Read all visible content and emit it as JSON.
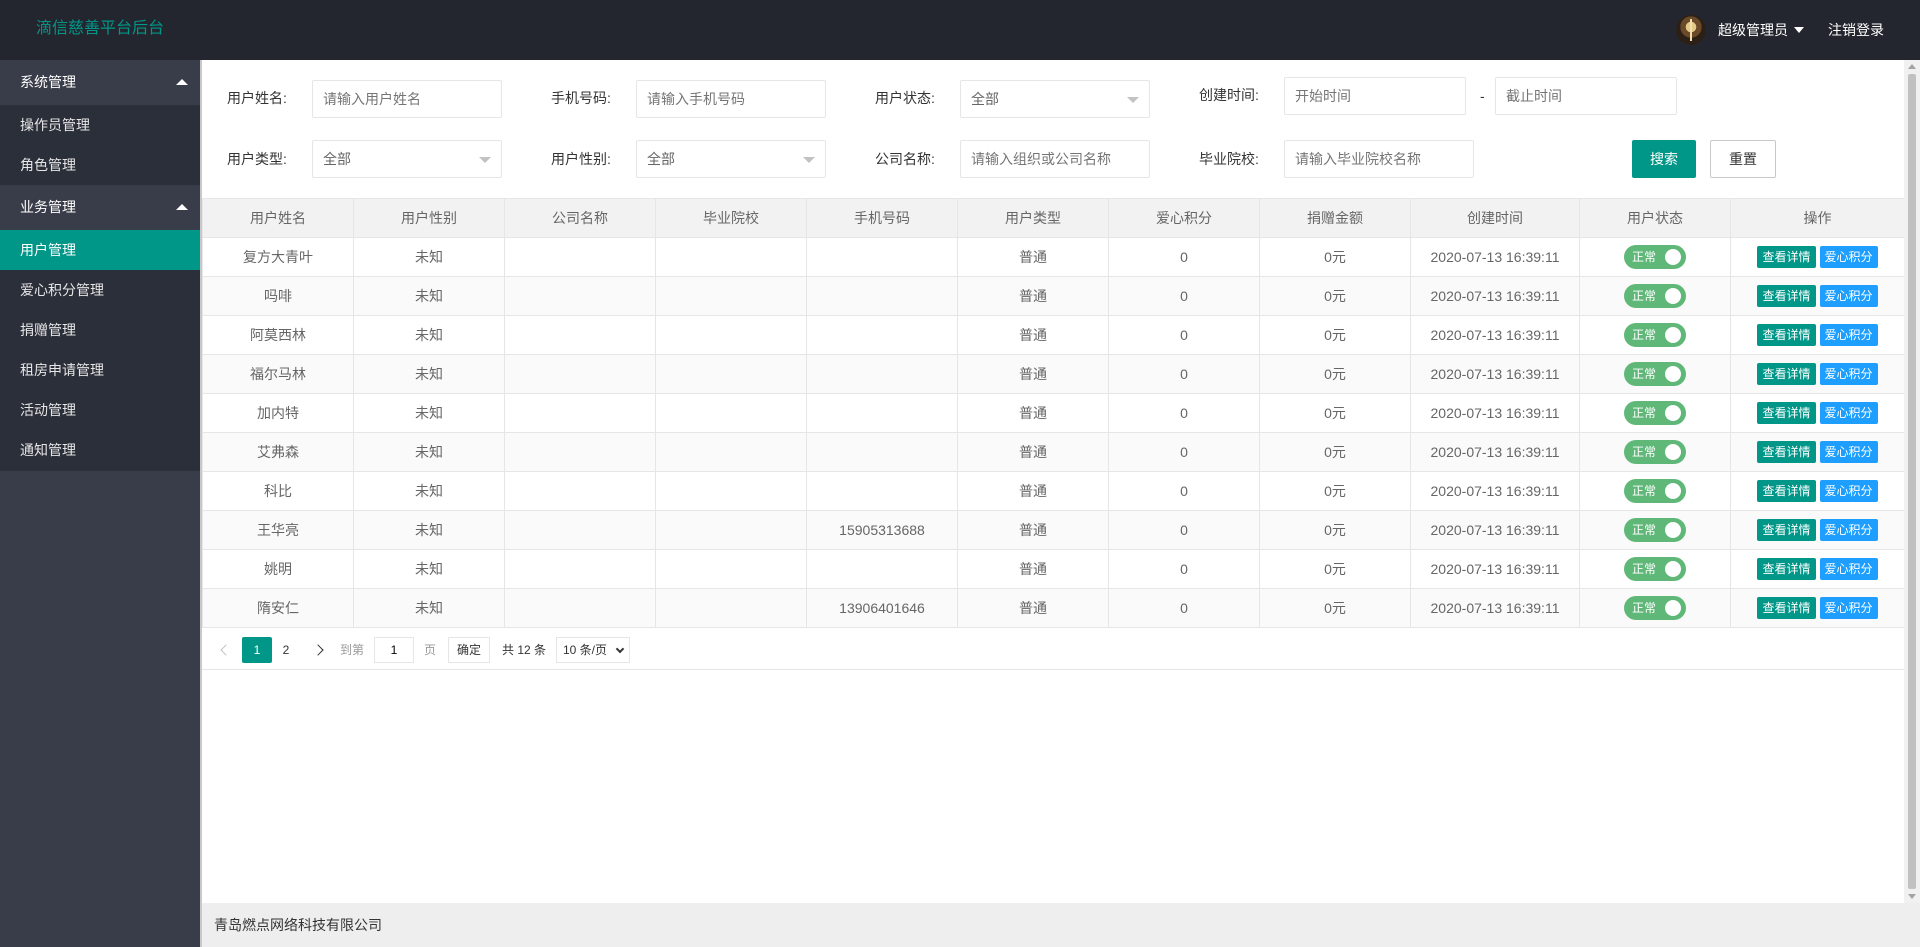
{
  "header": {
    "logo": "滴信慈善平台后台",
    "user_name": "超级管理员",
    "logout": "注销登录"
  },
  "sidebar": {
    "group1": {
      "title": "系统管理",
      "items": [
        {
          "label": "操作员管理"
        },
        {
          "label": "角色管理"
        }
      ]
    },
    "group2": {
      "title": "业务管理",
      "items": [
        {
          "label": "用户管理"
        },
        {
          "label": "爱心积分管理"
        },
        {
          "label": "捐赠管理"
        },
        {
          "label": "租房申请管理"
        },
        {
          "label": "活动管理"
        },
        {
          "label": "通知管理"
        }
      ]
    },
    "active": "用户管理"
  },
  "filters": {
    "name_label": "用户姓名:",
    "name_placeholder": "请输入用户姓名",
    "phone_label": "手机号码:",
    "phone_placeholder": "请输入手机号码",
    "status_label": "用户状态:",
    "status_value": "全部",
    "created_label": "创建时间:",
    "start_placeholder": "开始时间",
    "dash": "-",
    "end_placeholder": "截止时间",
    "type_label": "用户类型:",
    "type_value": "全部",
    "gender_label": "用户性别:",
    "gender_value": "全部",
    "company_label": "公司名称:",
    "company_placeholder": "请输入组织或公司名称",
    "school_label": "毕业院校:",
    "school_placeholder": "请输入毕业院校名称",
    "search_btn": "搜索",
    "reset_btn": "重置"
  },
  "table": {
    "columns": [
      "用户姓名",
      "用户性别",
      "公司名称",
      "毕业院校",
      "手机号码",
      "用户类型",
      "爱心积分",
      "捐赠金额",
      "创建时间",
      "用户状态",
      "操作"
    ],
    "rows": [
      {
        "name": "复方大青叶",
        "gender": "未知",
        "company": "",
        "school": "",
        "phone": "",
        "type": "普通",
        "points": "0",
        "amount": "0元",
        "created": "2020-07-13 16:39:11",
        "status": "正常"
      },
      {
        "name": "吗啡",
        "gender": "未知",
        "company": "",
        "school": "",
        "phone": "",
        "type": "普通",
        "points": "0",
        "amount": "0元",
        "created": "2020-07-13 16:39:11",
        "status": "正常"
      },
      {
        "name": "阿莫西林",
        "gender": "未知",
        "company": "",
        "school": "",
        "phone": "",
        "type": "普通",
        "points": "0",
        "amount": "0元",
        "created": "2020-07-13 16:39:11",
        "status": "正常"
      },
      {
        "name": "福尔马林",
        "gender": "未知",
        "company": "",
        "school": "",
        "phone": "",
        "type": "普通",
        "points": "0",
        "amount": "0元",
        "created": "2020-07-13 16:39:11",
        "status": "正常"
      },
      {
        "name": "加内特",
        "gender": "未知",
        "company": "",
        "school": "",
        "phone": "",
        "type": "普通",
        "points": "0",
        "amount": "0元",
        "created": "2020-07-13 16:39:11",
        "status": "正常"
      },
      {
        "name": "艾弗森",
        "gender": "未知",
        "company": "",
        "school": "",
        "phone": "",
        "type": "普通",
        "points": "0",
        "amount": "0元",
        "created": "2020-07-13 16:39:11",
        "status": "正常"
      },
      {
        "name": "科比",
        "gender": "未知",
        "company": "",
        "school": "",
        "phone": "",
        "type": "普通",
        "points": "0",
        "amount": "0元",
        "created": "2020-07-13 16:39:11",
        "status": "正常"
      },
      {
        "name": "王华亮",
        "gender": "未知",
        "company": "",
        "school": "",
        "phone": "15905313688",
        "type": "普通",
        "points": "0",
        "amount": "0元",
        "created": "2020-07-13 16:39:11",
        "status": "正常"
      },
      {
        "name": "姚明",
        "gender": "未知",
        "company": "",
        "school": "",
        "phone": "",
        "type": "普通",
        "points": "0",
        "amount": "0元",
        "created": "2020-07-13 16:39:11",
        "status": "正常"
      },
      {
        "name": "隋安仁",
        "gender": "未知",
        "company": "",
        "school": "",
        "phone": "13906401646",
        "type": "普通",
        "points": "0",
        "amount": "0元",
        "created": "2020-07-13 16:39:11",
        "status": "正常"
      }
    ],
    "op_detail": "查看详情",
    "op_points": "爱心积分"
  },
  "pager": {
    "current": "1",
    "page2": "2",
    "goto_label": "到第",
    "goto_value": "1",
    "page_unit": "页",
    "confirm": "确定",
    "total": "共 12 条",
    "page_size": "10 条/页"
  },
  "footer": {
    "text": "青岛燃点网络科技有限公司"
  },
  "colors": {
    "header_bg": "#23262e",
    "sidebar_bg": "#393d49",
    "accent": "#009688",
    "blue": "#1e9fff",
    "switch_on": "#5fb878"
  }
}
